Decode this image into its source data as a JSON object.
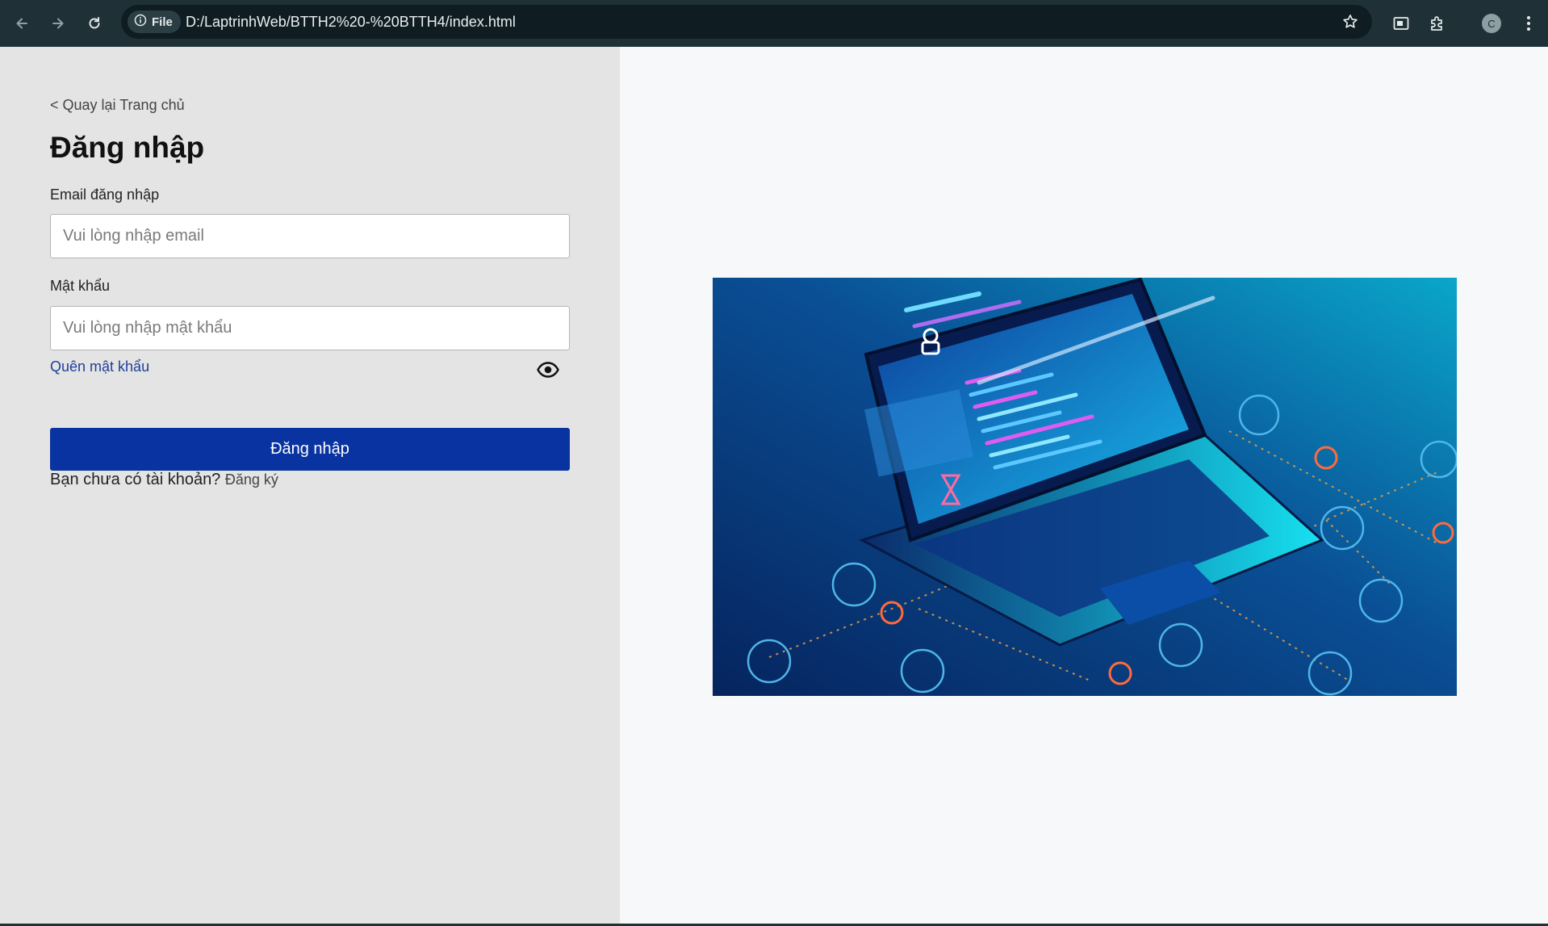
{
  "browser": {
    "site_chip_label": "File",
    "url": "D:/LaptrinhWeb/BTTH2%20-%20BTTH4/index.html",
    "profile_initial": "C"
  },
  "login": {
    "back_link": "< Quay lại Trang chủ",
    "title": "Đăng nhập",
    "email_label": "Email đăng nhập",
    "email_placeholder": "Vui lòng nhập email",
    "email_value": "",
    "password_label": "Mật khẩu",
    "password_placeholder": "Vui lòng nhập mật khẩu",
    "password_value": "",
    "forgot_link": "Quên mật khẩu",
    "submit_label": "Đăng nhập",
    "no_account_text": "Bạn chưa có tài khoản?",
    "signup_link": "Đăng ký"
  },
  "colors": {
    "primary_button": "#0933a1",
    "left_panel_bg": "#e4e4e4",
    "link_blue": "#1d3f9a"
  }
}
